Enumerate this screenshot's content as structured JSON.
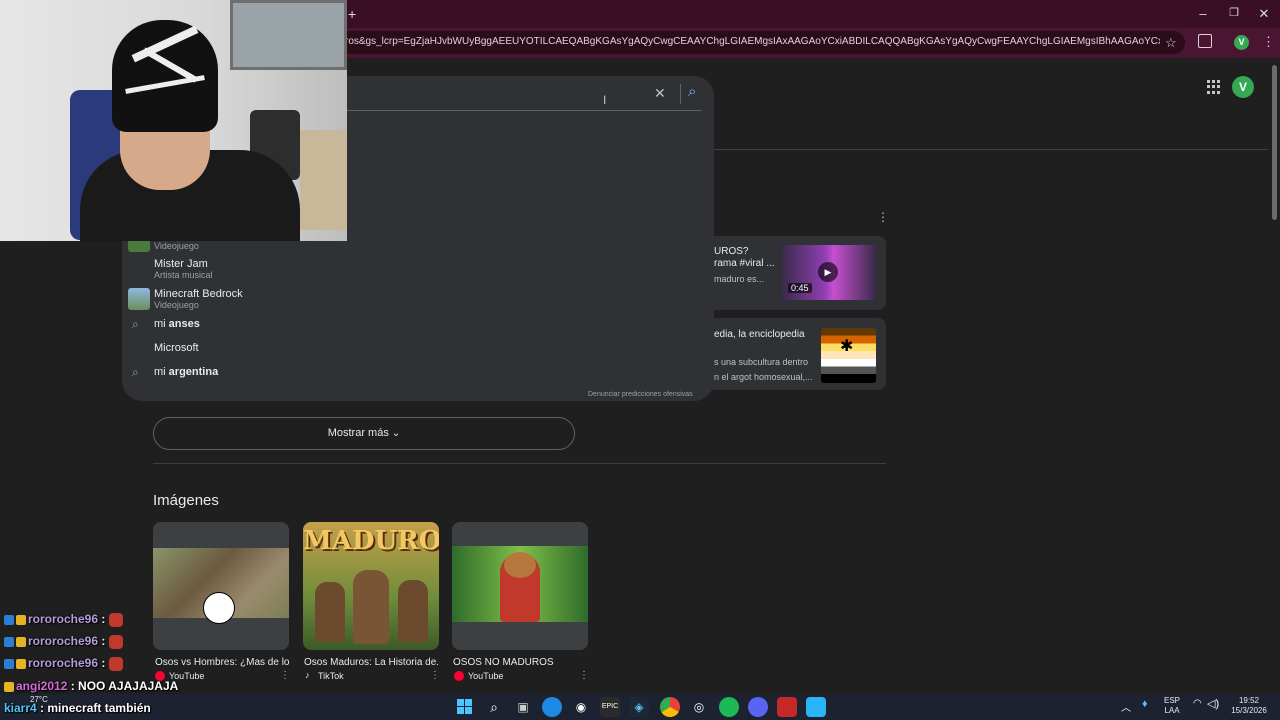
{
  "browser": {
    "url": "ros&gs_lcrp=EgZjaHJvbWUyBggAEEUYOTILCAEQABgKGAsYgAQyCwgCEAAYChgLGIAEMgsIAxAAGAoYCxiABDILCAQQABgKGAsYgAQyCwgFEAAYChgLGIAEMgsIBhAAGAoYCxiABDILCAcQABgKGAsYg",
    "new_tab": "+",
    "minimize": "–",
    "restore": "❐",
    "close": "✕",
    "profile_initial": "V"
  },
  "page": {
    "profile_initial": "V",
    "apps_icon": "⋮⋮⋮",
    "search_clear": "✕",
    "search_icon": "⌕",
    "suggestions": [
      {
        "title": "",
        "subtitle": "Videojuego",
        "kind": "entity"
      },
      {
        "title": "Mister Jam",
        "subtitle": "Artista musical",
        "kind": "text"
      },
      {
        "title": "Minecraft Bedrock",
        "subtitle": "Videojuego",
        "kind": "entity"
      },
      {
        "prefix": "mi ",
        "bold": "anses",
        "kind": "search"
      },
      {
        "prefix": "Microsoft",
        "bold": "",
        "kind": "plain"
      },
      {
        "prefix": "mi ",
        "bold": "argentina",
        "kind": "search"
      }
    ],
    "report_text": "Denunciar predicciones ofensivas",
    "card_menu_icon": "⋮",
    "video_card": {
      "title1": "UROS?",
      "title2": "rama #viral ...",
      "snippet": "maduro es...",
      "duration": "0:45"
    },
    "wiki_card": {
      "title": "edia, la enciclopedia",
      "snippet1": "s una subcultura dentro",
      "snippet2": "n el argot homosexual,..."
    },
    "show_more": "Mostrar más",
    "images_heading": "Imágenes",
    "images": [
      {
        "caption": "Osos vs Hombres: ¿Mas de lo...",
        "source": "YouTube"
      },
      {
        "caption": "Osos Maduros: La Historia de...",
        "source": "TikTok",
        "overlay": "MADUROS"
      },
      {
        "caption": "OSOS NO MADUROS",
        "source": "YouTube"
      }
    ]
  },
  "chat": [
    {
      "user": "rororoche96",
      "sep": " :",
      "msg": ""
    },
    {
      "user": "rororoche96",
      "sep": " :",
      "msg": ""
    },
    {
      "user": "rororoche96",
      "sep": " :",
      "msg": ""
    },
    {
      "user": "angi2012",
      "sep": " : ",
      "msg": "NOO AJAJAJAJA"
    },
    {
      "user": "kiarr4",
      "sep": " : ",
      "msg": "minecraft también"
    }
  ],
  "taskbar": {
    "weather": "27°C",
    "lang1": "ESP",
    "lang2": "LAA",
    "time": "19:52",
    "date": "15/3/2026"
  }
}
